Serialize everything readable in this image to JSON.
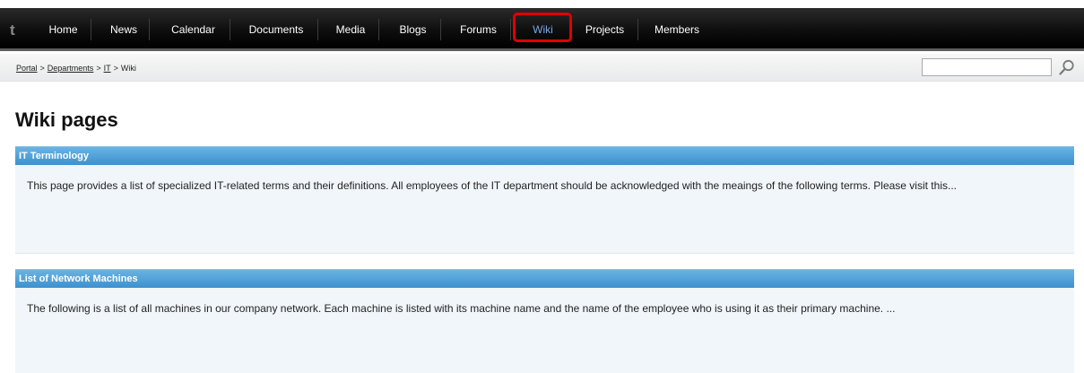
{
  "nav": {
    "logo": "t",
    "items": [
      {
        "label": "Home"
      },
      {
        "label": "News"
      },
      {
        "label": "Calendar"
      },
      {
        "label": "Documents"
      },
      {
        "label": "Media"
      },
      {
        "label": "Blogs"
      },
      {
        "label": "Forums"
      },
      {
        "label": "Wiki"
      },
      {
        "label": "Projects"
      },
      {
        "label": "Members"
      }
    ],
    "active_item": "Wiki",
    "active_color": "#7aa7e6",
    "highlight_color": "#e00000"
  },
  "breadcrumb": {
    "items": [
      "Portal",
      "Departments",
      "IT"
    ],
    "separator": ">",
    "current": "Wiki"
  },
  "search": {
    "value": "",
    "icon": "search-icon"
  },
  "page": {
    "title": "Wiki pages"
  },
  "wiki_pages": [
    {
      "title": "IT Terminology",
      "excerpt": "This page provides a list of specialized IT-related terms and their definitions. All employees of the IT department should be acknowledged with the meaings of the following terms. Please visit this..."
    },
    {
      "title": "List of Network Machines",
      "excerpt": "The following is a list of all machines in our company network. Each machine is listed with its machine name and the name of the employee who is using it as their primary machine. ..."
    }
  ],
  "colors": {
    "header_blue": "#3c91cf",
    "card_bg": "#f1f6fa",
    "nav_bg": "#000000"
  }
}
